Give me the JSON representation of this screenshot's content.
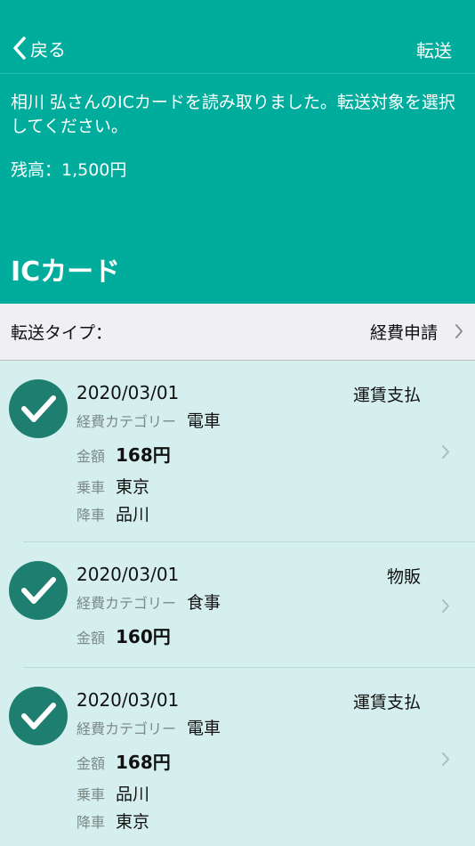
{
  "nav": {
    "back_label": "戻る",
    "transfer_label": "転送"
  },
  "message": "相川 弘さんのICカードを読み取りました。転送対象を選択してください。",
  "balance": "残高：1,500円",
  "section_title": "ICカード",
  "transfer_type": {
    "label": "転送タイプ：",
    "value": "経費申請"
  },
  "field_labels": {
    "category": "経費カテゴリー",
    "amount": "金額",
    "boarding": "乗車",
    "alighting": "降車"
  },
  "items": [
    {
      "date": "2020/03/01",
      "kind": "運賃支払",
      "category": "電車",
      "amount": "168円",
      "boarding": "東京",
      "alighting": "品川",
      "selected": true
    },
    {
      "date": "2020/03/01",
      "kind": "物販",
      "category": "食事",
      "amount": "160円",
      "selected": true
    },
    {
      "date": "2020/03/01",
      "kind": "運賃支払",
      "category": "電車",
      "amount": "168円",
      "boarding": "品川",
      "alighting": "東京",
      "selected": true
    }
  ],
  "colors": {
    "header": "#00ac9c",
    "list_bg": "#d4efed",
    "check": "#1e7f70",
    "type_row": "#efeff4"
  },
  "icons": {
    "back": "chevron-left-icon",
    "check": "checkmark-circle-icon",
    "disclosure": "chevron-right-icon"
  }
}
